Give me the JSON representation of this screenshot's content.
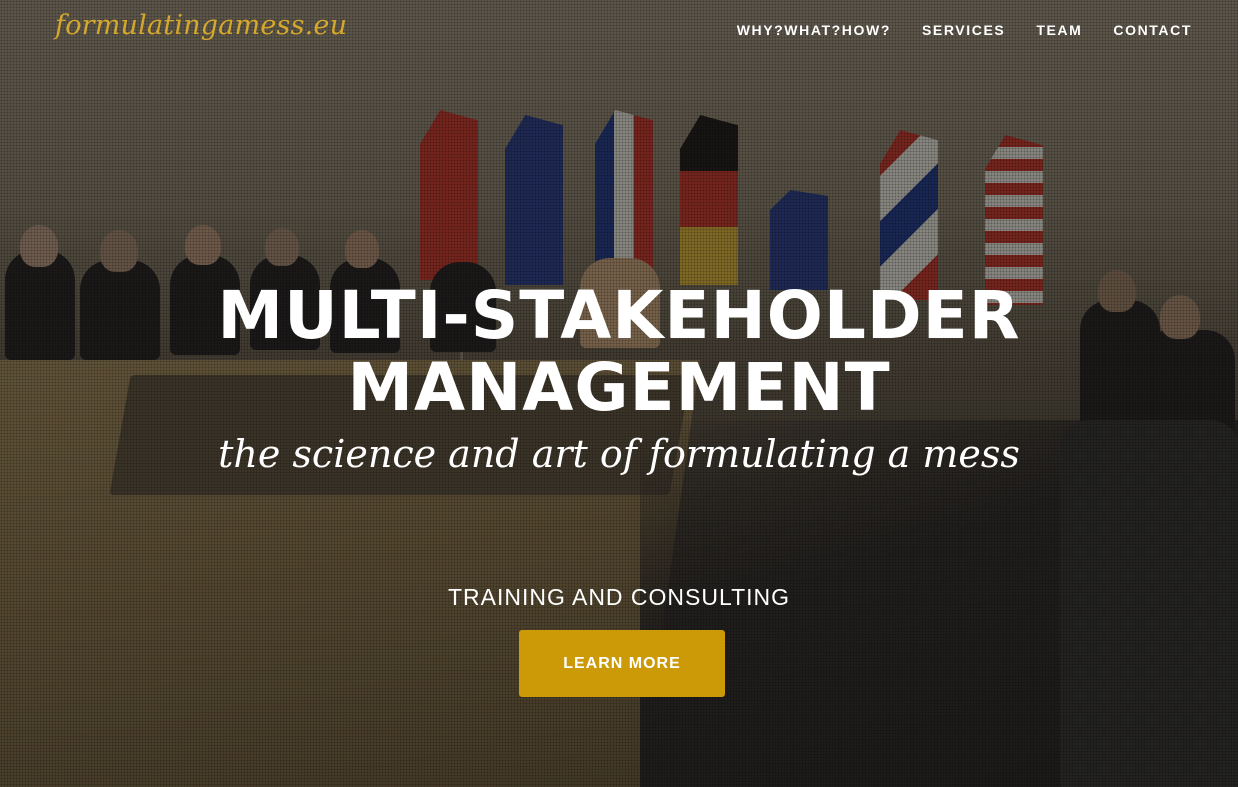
{
  "header": {
    "brand": "formulatingamess.eu",
    "nav": [
      {
        "label": "WHY?WHAT?HOW?"
      },
      {
        "label": "SERVICES"
      },
      {
        "label": "TEAM"
      },
      {
        "label": "CONTACT"
      }
    ]
  },
  "hero": {
    "title_line1": "MULTI-STAKEHOLDER",
    "title_line2": "MANAGEMENT",
    "subtitle": "the science and art of formulating a mess",
    "tagline": "TRAINING AND CONSULTING",
    "cta_label": "LEARN MORE"
  },
  "colors": {
    "brand": "#d4a82c",
    "cta_background": "#cc9a06",
    "text": "#ffffff"
  }
}
